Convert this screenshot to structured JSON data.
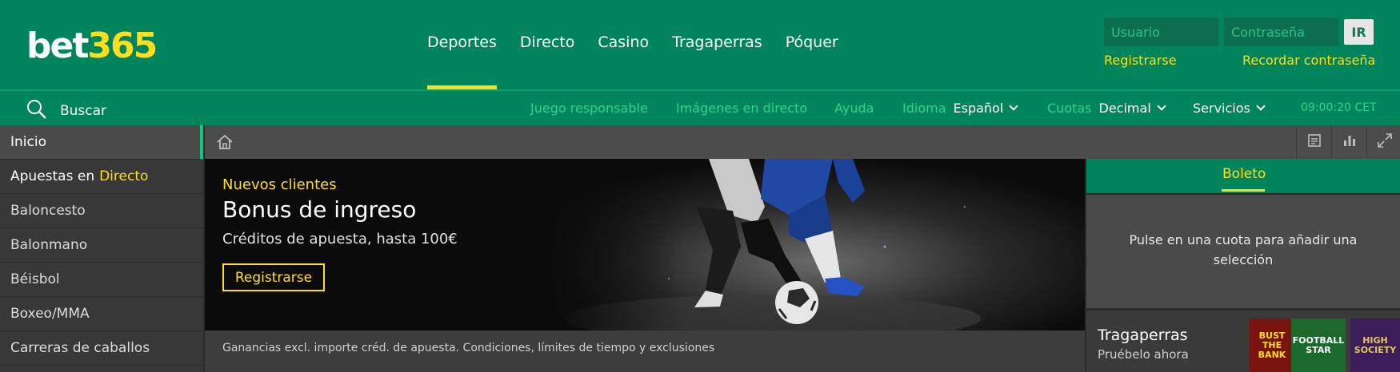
{
  "brand": {
    "part1": "bet",
    "part2": "365"
  },
  "main_nav": [
    "Deportes",
    "Directo",
    "Casino",
    "Tragaperras",
    "Póquer"
  ],
  "login": {
    "user_placeholder": "Usuario",
    "password_placeholder": "Contraseña",
    "submit_label": "IR",
    "register_label": "Registrarse",
    "remember_label": "Recordar contraseña"
  },
  "subnav": {
    "search_label": "Buscar",
    "responsible": "Juego responsable",
    "live_images": "Imágenes en directo",
    "help": "Ayuda",
    "language_label": "Idioma",
    "language_value": "Español",
    "odds_label": "Cuotas",
    "odds_value": "Decimal",
    "services": "Servicios",
    "time": "09:00:20 CET"
  },
  "sidebar": {
    "home": "Inicio",
    "live_prefix": "Apuestas en",
    "live_highlight": "Directo",
    "sports": [
      "Baloncesto",
      "Balonmano",
      "Béisbol",
      "Boxeo/MMA",
      "Carreras de caballos"
    ]
  },
  "banner": {
    "eyebrow": "Nuevos clientes",
    "title": "Bonus de ingreso",
    "subtitle": "Créditos de apuesta, hasta 100€",
    "cta": "Registrarse",
    "terms": "Ganancias excl. importe créd. de apuesta. Condiciones, límites de tiempo y exclusiones"
  },
  "bet_slip": {
    "tab": "Boleto",
    "empty_message": "Pulse en una cuota para añadir una selección"
  },
  "slots_promo": {
    "title": "Tragaperras",
    "subtitle": "Pruébelo ahora",
    "games": [
      "BUST THE BANK",
      "FOOTBALL STAR",
      "HIGH SOCIETY"
    ]
  },
  "colors": {
    "brand_green": "#00845b",
    "accent_yellow": "#ffdf1b",
    "link_green": "#2fd38f",
    "dark_bg": "#2b2b2b"
  }
}
